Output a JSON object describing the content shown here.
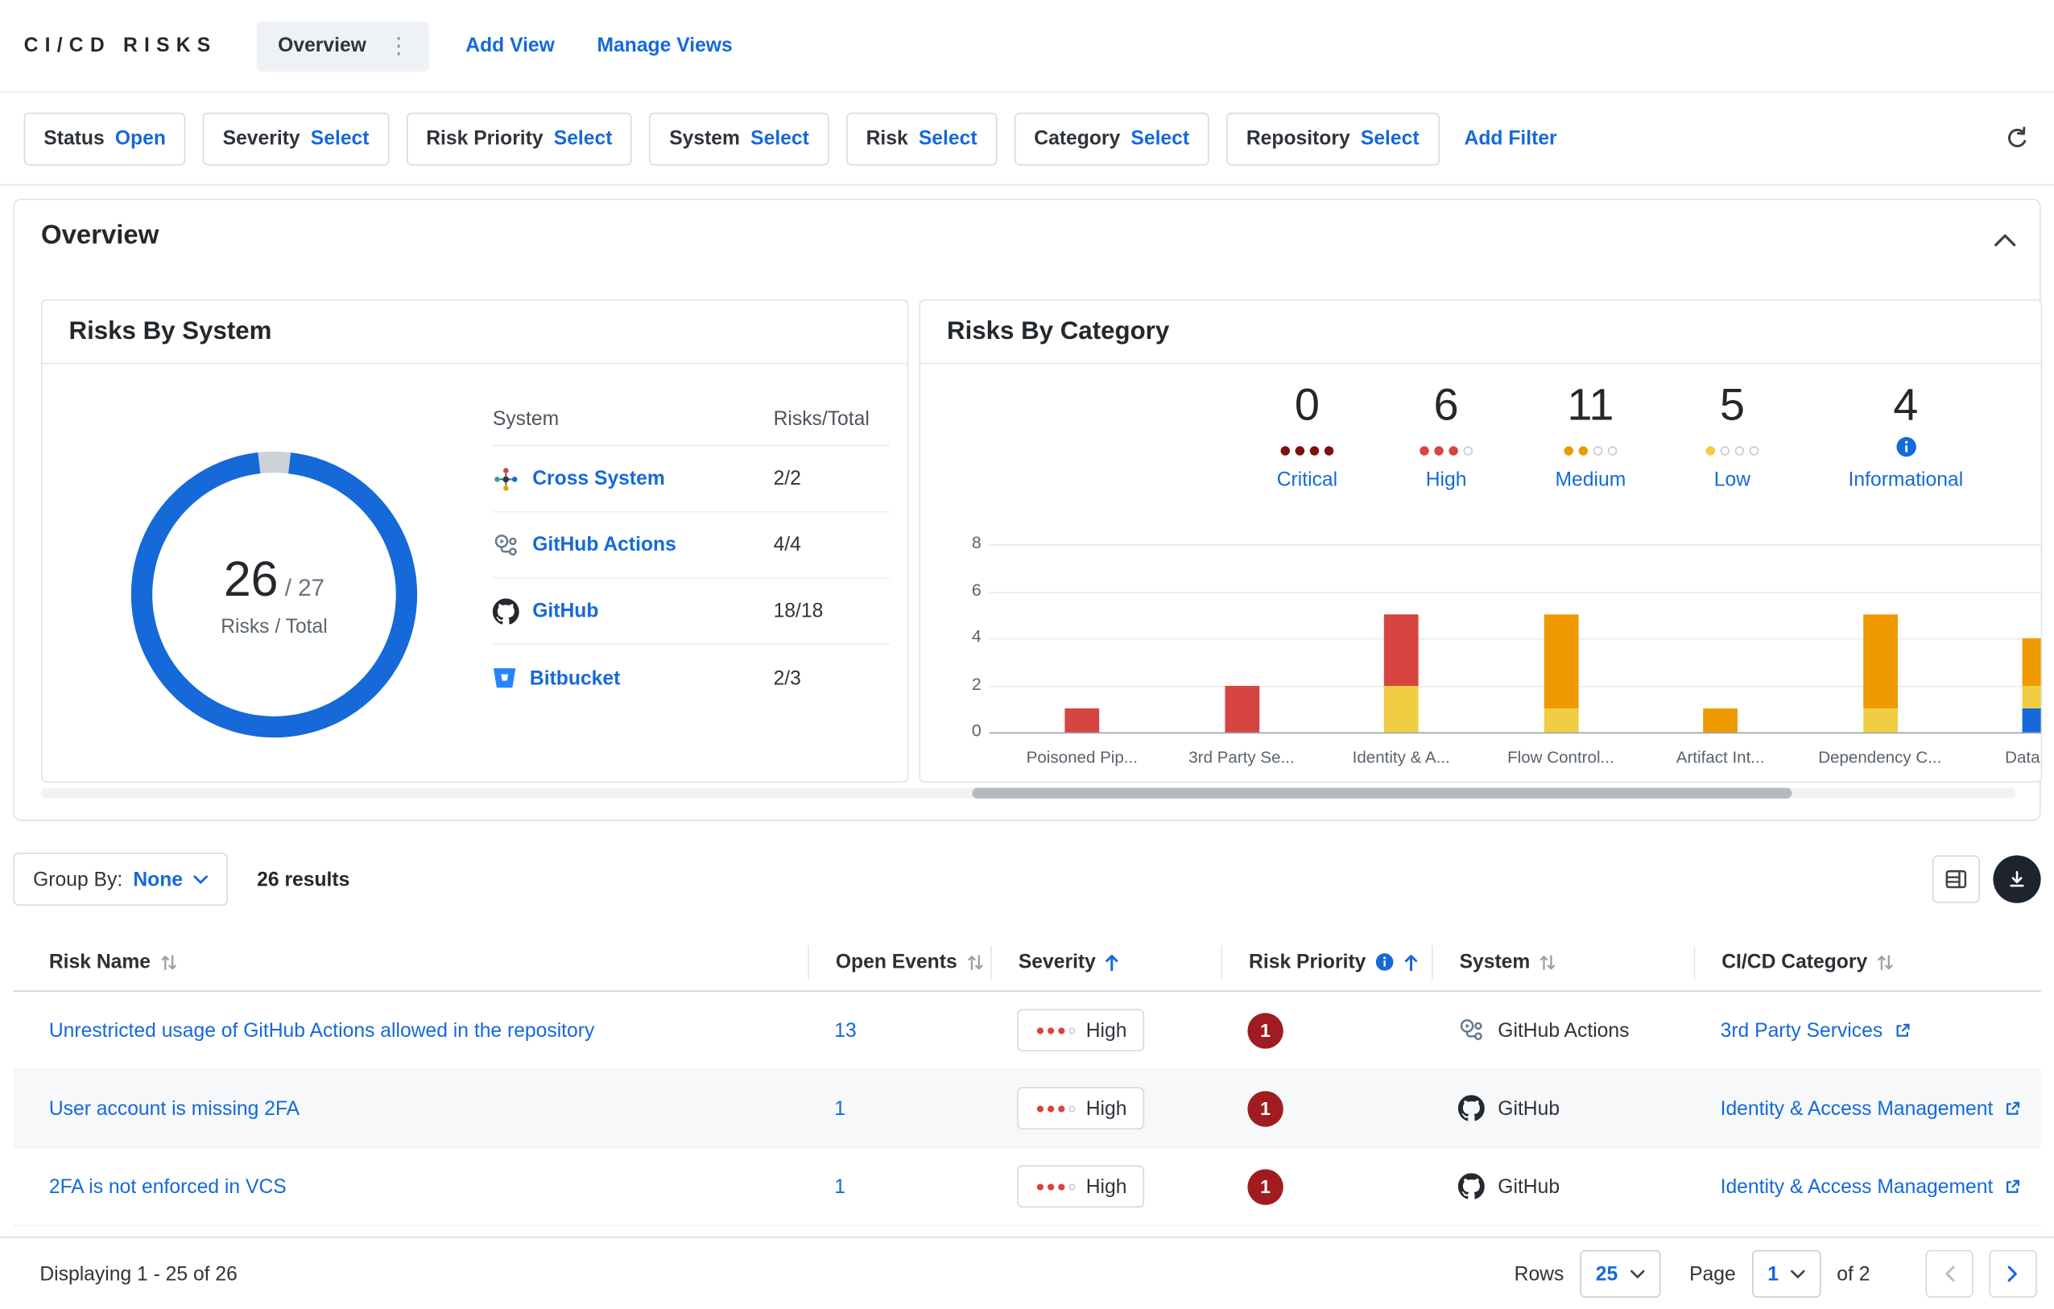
{
  "brand": "CI/CD RISKS",
  "nav": {
    "tab_overview": "Overview",
    "add_view": "Add View",
    "manage_views": "Manage Views"
  },
  "filter_bar": {
    "chips": [
      {
        "label": "Status",
        "value": "Open"
      },
      {
        "label": "Severity",
        "value": "Select"
      },
      {
        "label": "Risk Priority",
        "value": "Select"
      },
      {
        "label": "System",
        "value": "Select"
      },
      {
        "label": "Risk",
        "value": "Select"
      },
      {
        "label": "Category",
        "value": "Select"
      },
      {
        "label": "Repository",
        "value": "Select"
      }
    ],
    "add_filter": "Add Filter"
  },
  "overview_panel": {
    "title": "Overview",
    "risks_by_system": {
      "title": "Risks By System",
      "center_value": "26",
      "center_total": "/ 27",
      "center_label": "Risks / Total",
      "col_system": "System",
      "col_risks": "Risks/Total",
      "rows": [
        {
          "system": "Cross System",
          "value": "2/2"
        },
        {
          "system": "GitHub Actions",
          "value": "4/4"
        },
        {
          "system": "GitHub",
          "value": "18/18"
        },
        {
          "system": "Bitbucket",
          "value": "2/3"
        }
      ]
    },
    "risks_by_category": {
      "title": "Risks By Category",
      "summary": [
        {
          "count": "0",
          "label": "Critical",
          "filled": 4,
          "total": 4,
          "color": "#7d120b"
        },
        {
          "count": "6",
          "label": "High",
          "filled": 3,
          "total": 4,
          "color": "#d64540"
        },
        {
          "count": "11",
          "label": "Medium",
          "filled": 2,
          "total": 4,
          "color": "#ef9b00"
        },
        {
          "count": "5",
          "label": "Low",
          "filled": 1,
          "total": 4,
          "color": "#f0cd42"
        },
        {
          "count": "4",
          "label": "Informational",
          "info": true
        }
      ]
    }
  },
  "chart_data": [
    {
      "type": "pie",
      "variant": "donut",
      "title": "Risks By System",
      "values": [
        {
          "label": "Risks",
          "value": 26
        },
        {
          "label": "Remaining",
          "value": 1
        }
      ],
      "center_text": "26 / 27 Risks / Total",
      "colors": [
        "#1569d9",
        "#ccd2d8"
      ]
    },
    {
      "type": "bar",
      "stacked": true,
      "title": "Risks By Category",
      "categories": [
        "Poisoned Pip...",
        "3rd Party Se...",
        "Identity & A...",
        "Flow Control...",
        "Artifact Int...",
        "Dependency C...",
        "Data Pr..."
      ],
      "series": [
        {
          "name": "Informational",
          "color": "#1569d9",
          "values": [
            0,
            0,
            0,
            0,
            0,
            0,
            1
          ]
        },
        {
          "name": "Low",
          "color": "#f0cd42",
          "values": [
            0,
            0,
            2,
            1,
            0,
            1,
            1
          ]
        },
        {
          "name": "Medium",
          "color": "#ef9b00",
          "values": [
            0,
            0,
            0,
            4,
            1,
            4,
            2
          ]
        },
        {
          "name": "High",
          "color": "#d64540",
          "values": [
            1,
            2,
            3,
            0,
            0,
            0,
            0
          ]
        }
      ],
      "ylim": [
        0,
        8
      ],
      "yticks": [
        0,
        2,
        4,
        6,
        8
      ],
      "grid": true,
      "legend": false
    }
  ],
  "results_bar": {
    "group_by_label": "Group By:",
    "group_by_value": "None",
    "results": "26 results"
  },
  "risk_table": {
    "columns": [
      "Risk Name",
      "Open Events",
      "Severity",
      "Risk Priority",
      "System",
      "CI/CD Category"
    ],
    "rows": [
      {
        "name": "Unrestricted usage of GitHub Actions allowed in the repository",
        "open_events": "13",
        "severity": "High",
        "severity_filled": 3,
        "severity_total": 4,
        "priority": "1",
        "system": "GitHub Actions",
        "category": "3rd Party Services"
      },
      {
        "name": "User account is missing 2FA",
        "open_events": "1",
        "severity": "High",
        "severity_filled": 3,
        "severity_total": 4,
        "priority": "1",
        "system": "GitHub",
        "category": "Identity & Access Management"
      },
      {
        "name": "2FA is not enforced in VCS",
        "open_events": "1",
        "severity": "High",
        "severity_filled": 3,
        "severity_total": 4,
        "priority": "1",
        "system": "GitHub",
        "category": "Identity & Access Management"
      }
    ]
  },
  "pagination": {
    "displaying": "Displaying 1 - 25 of 26",
    "rows_label": "Rows",
    "rows_value": "25",
    "page_label": "Page",
    "page_value": "1",
    "of_label": "of 2"
  },
  "colors": {
    "accent_blue": "#1569d9",
    "severity_critical": "#7d120b",
    "severity_high": "#d64540",
    "severity_medium": "#ef9b00",
    "severity_low": "#f0cd42",
    "priority_badge": "#a01c20",
    "donut_blue": "#1569d9",
    "donut_rest": "#ccd2d8"
  }
}
